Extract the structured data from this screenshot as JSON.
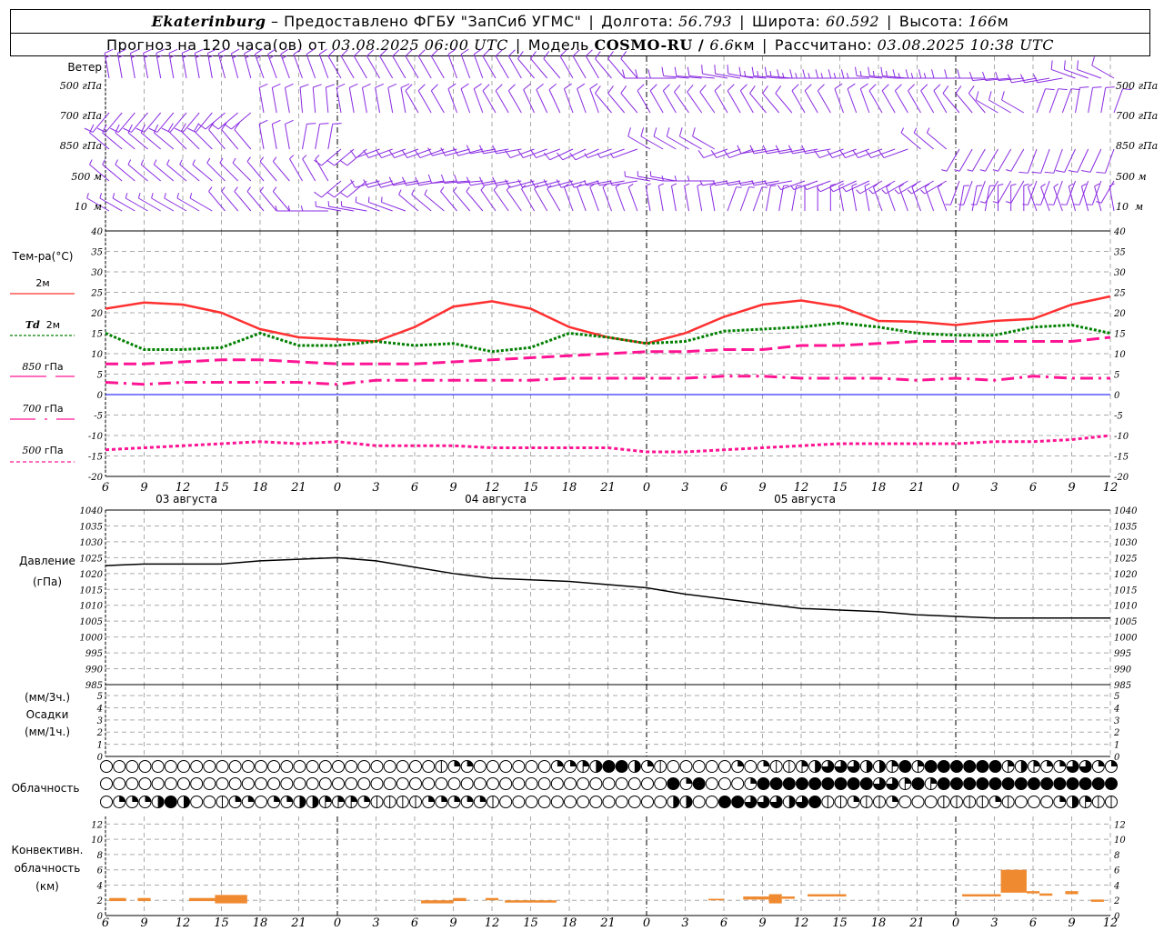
{
  "header": {
    "city": "Ekaterinburg",
    "provider": " – Предоставлено ФГБУ \"ЗапСиб УГМС\"",
    "lon_label": "Долгота: ",
    "lon": "56.793",
    "lat_label": "Широта: ",
    "lat": "60.592",
    "alt_label": "Высота: ",
    "alt": "166",
    "alt_unit": "м",
    "forecast_label": "Прогноз на 120 часа(ов) от ",
    "forecast_start": "03.08.2025 06:00 UTC",
    "model_label": "Модель ",
    "model": "COSMO-RU / ",
    "res": "6.6",
    "res_unit": "км",
    "calc_label": "Рассчитано: ",
    "calc_time": "03.08.2025 10:38 UTC"
  },
  "wind": {
    "title": "Ветер",
    "levels": [
      "500 гПа",
      "700 гПа",
      "850 гПа",
      "500 м",
      "10  м"
    ]
  },
  "temp_legend": {
    "title": "Тем-ра(°С)",
    "t2m": "2м",
    "td": "Td",
    "td2": "2м",
    "p850": "850",
    "p700": "700",
    "p500": "500",
    "unit": "гПа"
  },
  "pressure_labels": {
    "title": "Давление",
    "unit": "(гПа)"
  },
  "precip_labels": {
    "l1": "(мм/3ч.)",
    "l2": "Осадки",
    "l3": "(мм/1ч.)"
  },
  "cloud_label": "Облачность",
  "conv_labels": {
    "l1": "Конвективн.",
    "l2": "облачность",
    "l3": "(км)"
  },
  "colors": {
    "t2m": "#ff3030",
    "td": "#008000",
    "p850": "#ff1493",
    "p700": "#ff1493",
    "p500": "#ff1493",
    "wind": "#8a2be2",
    "zero": "#0000ff",
    "conv": "#f08a30"
  },
  "chart_data": {
    "type": "meteogram",
    "time_ticks": [
      "6",
      "9",
      "12",
      "15",
      "18",
      "21",
      "0",
      "3",
      "6",
      "9",
      "12",
      "15",
      "18",
      "21",
      "0",
      "3",
      "6",
      "9",
      "12",
      "15",
      "18",
      "21",
      "0",
      "3",
      "6",
      "9",
      "12"
    ],
    "dates": [
      "03 августа",
      "04 августа",
      "05 августа"
    ],
    "hours_span": 78,
    "temperature": {
      "ylim": [
        -20,
        40
      ],
      "ticks": [
        "40",
        "35",
        "30",
        "25",
        "20",
        "15",
        "10",
        "5",
        "0",
        "-5",
        "-10",
        "-15",
        "-20"
      ],
      "t2m": [
        21,
        22.5,
        22,
        20,
        16,
        14,
        13.5,
        13,
        16.5,
        21.5,
        22.8,
        21,
        16.5,
        14,
        12.5,
        15,
        19,
        22,
        23,
        21.5,
        18,
        17.8,
        17,
        18,
        18.5,
        22,
        24
      ],
      "td2m": [
        15,
        11,
        11,
        11.5,
        15,
        12,
        12,
        13,
        12,
        12.5,
        10.5,
        11.5,
        15,
        14,
        12.5,
        13,
        15.5,
        16,
        16.5,
        17.5,
        16.5,
        15,
        14.5,
        14.5,
        16.5,
        17,
        15
      ],
      "t850": [
        7.5,
        7.5,
        8,
        8.5,
        8.5,
        8,
        7.5,
        7.5,
        7.5,
        8,
        8.5,
        9,
        9.5,
        10,
        10.5,
        10.5,
        11,
        11,
        12,
        12,
        12.5,
        13,
        13,
        13,
        13,
        13,
        14
      ],
      "t700": [
        3,
        2.5,
        3,
        3,
        3,
        3,
        2.5,
        3.5,
        3.5,
        3.5,
        3.5,
        3.5,
        4,
        4,
        4,
        4,
        4.5,
        4.5,
        4,
        4,
        4,
        3.5,
        4,
        3.5,
        4.5,
        4,
        4
      ],
      "t500": [
        -13.5,
        -13,
        -12.5,
        -12,
        -11.5,
        -12,
        -11.5,
        -12.5,
        -12.5,
        -12.5,
        -13,
        -13,
        -13,
        -13,
        -14,
        -14,
        -13.5,
        -13,
        -12.5,
        -12,
        -12,
        -12,
        -12,
        -11.5,
        -11.5,
        -11,
        -10
      ]
    },
    "pressure": {
      "ylim": [
        985,
        1040
      ],
      "ticks": [
        "1040",
        "1035",
        "1030",
        "1025",
        "1020",
        "1015",
        "1010",
        "1005",
        "1000",
        "995",
        "990",
        "985"
      ],
      "values": [
        1022.5,
        1023,
        1023,
        1023,
        1024,
        1024.5,
        1025,
        1024,
        1022,
        1020,
        1018.5,
        1018,
        1017.5,
        1016.5,
        1015.5,
        1013.5,
        1012,
        1010.5,
        1009,
        1008.5,
        1008,
        1007,
        1006.5,
        1006,
        1006,
        1006,
        1006
      ]
    },
    "precip": {
      "ylim": [
        0,
        5.5
      ],
      "ticks": [
        "5",
        "4",
        "3",
        "2",
        "1",
        "0"
      ],
      "values": []
    },
    "wind": {
      "dir_speed_by_level": [
        [
          [
            350,
            15
          ],
          [
            350,
            15
          ],
          [
            350,
            15
          ],
          [
            345,
            14
          ],
          [
            340,
            13
          ],
          [
            340,
            12
          ],
          [
            330,
            12
          ],
          [
            330,
            12
          ],
          [
            330,
            11
          ],
          [
            340,
            11
          ],
          [
            330,
            12
          ],
          [
            320,
            12
          ],
          [
            330,
            12
          ],
          [
            320,
            12
          ],
          [
            270,
            10
          ],
          [
            275,
            11
          ],
          [
            280,
            12
          ],
          [
            275,
            13
          ],
          [
            270,
            14
          ],
          [
            270,
            15
          ],
          [
            275,
            14
          ],
          [
            270,
            13
          ],
          [
            270,
            12
          ],
          [
            265,
            10
          ],
          [
            260,
            10
          ],
          [
            290,
            10
          ],
          [
            300,
            10
          ]
        ],
        [
          [
            220,
            12
          ],
          [
            220,
            12
          ],
          [
            220,
            11
          ],
          [
            230,
            10
          ],
          [
            350,
            10
          ],
          [
            355,
            11
          ],
          [
            350,
            11
          ],
          [
            350,
            10
          ],
          [
            330,
            10
          ],
          [
            340,
            12
          ],
          [
            330,
            12
          ],
          [
            335,
            12
          ],
          [
            340,
            12
          ],
          [
            320,
            10
          ],
          [
            330,
            10
          ],
          [
            325,
            9
          ],
          [
            330,
            10
          ],
          [
            320,
            10
          ],
          [
            330,
            9
          ],
          [
            340,
            10
          ],
          [
            330,
            9
          ],
          [
            330,
            9
          ],
          [
            320,
            8
          ],
          [
            300,
            8
          ],
          [
            20,
            8
          ],
          [
            10,
            8
          ],
          [
            20,
            8
          ]
        ],
        [
          [
            310,
            8
          ],
          [
            310,
            8
          ],
          [
            315,
            8
          ],
          [
            320,
            9
          ],
          [
            350,
            10
          ],
          [
            10,
            9
          ],
          [
            230,
            9
          ],
          [
            250,
            10
          ],
          [
            250,
            10
          ],
          [
            255,
            11
          ],
          [
            260,
            10
          ],
          [
            250,
            8
          ],
          [
            245,
            8
          ],
          [
            250,
            7
          ],
          [
            300,
            8
          ],
          [
            300,
            8
          ],
          [
            250,
            8
          ],
          [
            260,
            9
          ],
          [
            260,
            9
          ],
          [
            250,
            8
          ],
          [
            250,
            8
          ],
          [
            310,
            7
          ],
          [
            210,
            7
          ],
          [
            210,
            7
          ],
          [
            200,
            8
          ],
          [
            205,
            8
          ],
          [
            200,
            8
          ]
        ],
        [
          [
            310,
            7
          ],
          [
            310,
            7
          ],
          [
            310,
            7
          ],
          [
            315,
            7
          ],
          [
            320,
            7
          ],
          [
            330,
            7
          ],
          [
            230,
            8
          ],
          [
            255,
            9
          ],
          [
            260,
            8
          ],
          [
            265,
            8
          ],
          [
            260,
            8
          ],
          [
            255,
            8
          ],
          [
            255,
            8
          ],
          [
            260,
            7
          ],
          [
            280,
            7
          ],
          [
            270,
            7
          ],
          [
            260,
            7
          ],
          [
            260,
            7
          ],
          [
            250,
            7
          ],
          [
            245,
            7
          ],
          [
            240,
            7
          ],
          [
            240,
            6
          ],
          [
            200,
            6
          ],
          [
            210,
            6
          ],
          [
            200,
            6
          ],
          [
            200,
            6
          ],
          [
            210,
            6
          ]
        ],
        [
          [
            300,
            4
          ],
          [
            300,
            4
          ],
          [
            300,
            4
          ],
          [
            320,
            4
          ],
          [
            320,
            3
          ],
          [
            270,
            4
          ],
          [
            280,
            4
          ],
          [
            290,
            5
          ],
          [
            310,
            4
          ],
          [
            320,
            4
          ],
          [
            325,
            4
          ],
          [
            330,
            4
          ],
          [
            340,
            3
          ],
          [
            340,
            3
          ],
          [
            350,
            3
          ],
          [
            350,
            3
          ],
          [
            20,
            3
          ],
          [
            10,
            3
          ],
          [
            0,
            4
          ],
          [
            350,
            4
          ],
          [
            340,
            3
          ],
          [
            340,
            3
          ],
          [
            10,
            3
          ],
          [
            0,
            3
          ],
          [
            340,
            3
          ],
          [
            345,
            3
          ],
          [
            350,
            3
          ]
        ]
      ]
    },
    "cloud_cover_eighths": {
      "rows": [
        "00000000000000000000000000122000000223488421000002021134666443838888883432266222",
        "00000000000000000000000000000000000000000000828000288888888866383888888888888888888",
        "02224840012202244333211112222210000000000000440088666468112112000111121000253111110000"
      ]
    },
    "convective": {
      "ylim": [
        0,
        13
      ],
      "ticks": [
        "12",
        "10",
        "8",
        "6",
        "4",
        "2",
        "0"
      ],
      "bars": [
        [
          0.3,
          1.6,
          1.9,
          2.3
        ],
        [
          2.5,
          3.5,
          1.9,
          2.3
        ],
        [
          6.5,
          8.5,
          1.9,
          2.3
        ],
        [
          8.5,
          11,
          1.6,
          2.7
        ],
        [
          24.5,
          27,
          1.6,
          2
        ],
        [
          27,
          28,
          1.9,
          2.3
        ],
        [
          29.5,
          30.5,
          2,
          2.3
        ],
        [
          31,
          35,
          1.7,
          2
        ],
        [
          46.8,
          48,
          2,
          2.2
        ],
        [
          49.5,
          51.5,
          2.1,
          2.5
        ],
        [
          51.5,
          52.5,
          1.6,
          2.8
        ],
        [
          52.5,
          53.5,
          2.2,
          2.5
        ],
        [
          54.5,
          57.5,
          2.5,
          2.8
        ],
        [
          66.5,
          69.5,
          2.5,
          2.8
        ],
        [
          69.5,
          71.5,
          3,
          6
        ],
        [
          71.5,
          72.5,
          2.9,
          3.2
        ],
        [
          72.5,
          73.5,
          2.6,
          2.9
        ],
        [
          74.5,
          75.5,
          2.8,
          3.2
        ],
        [
          76.5,
          77.5,
          1.8,
          2.1
        ]
      ]
    }
  }
}
